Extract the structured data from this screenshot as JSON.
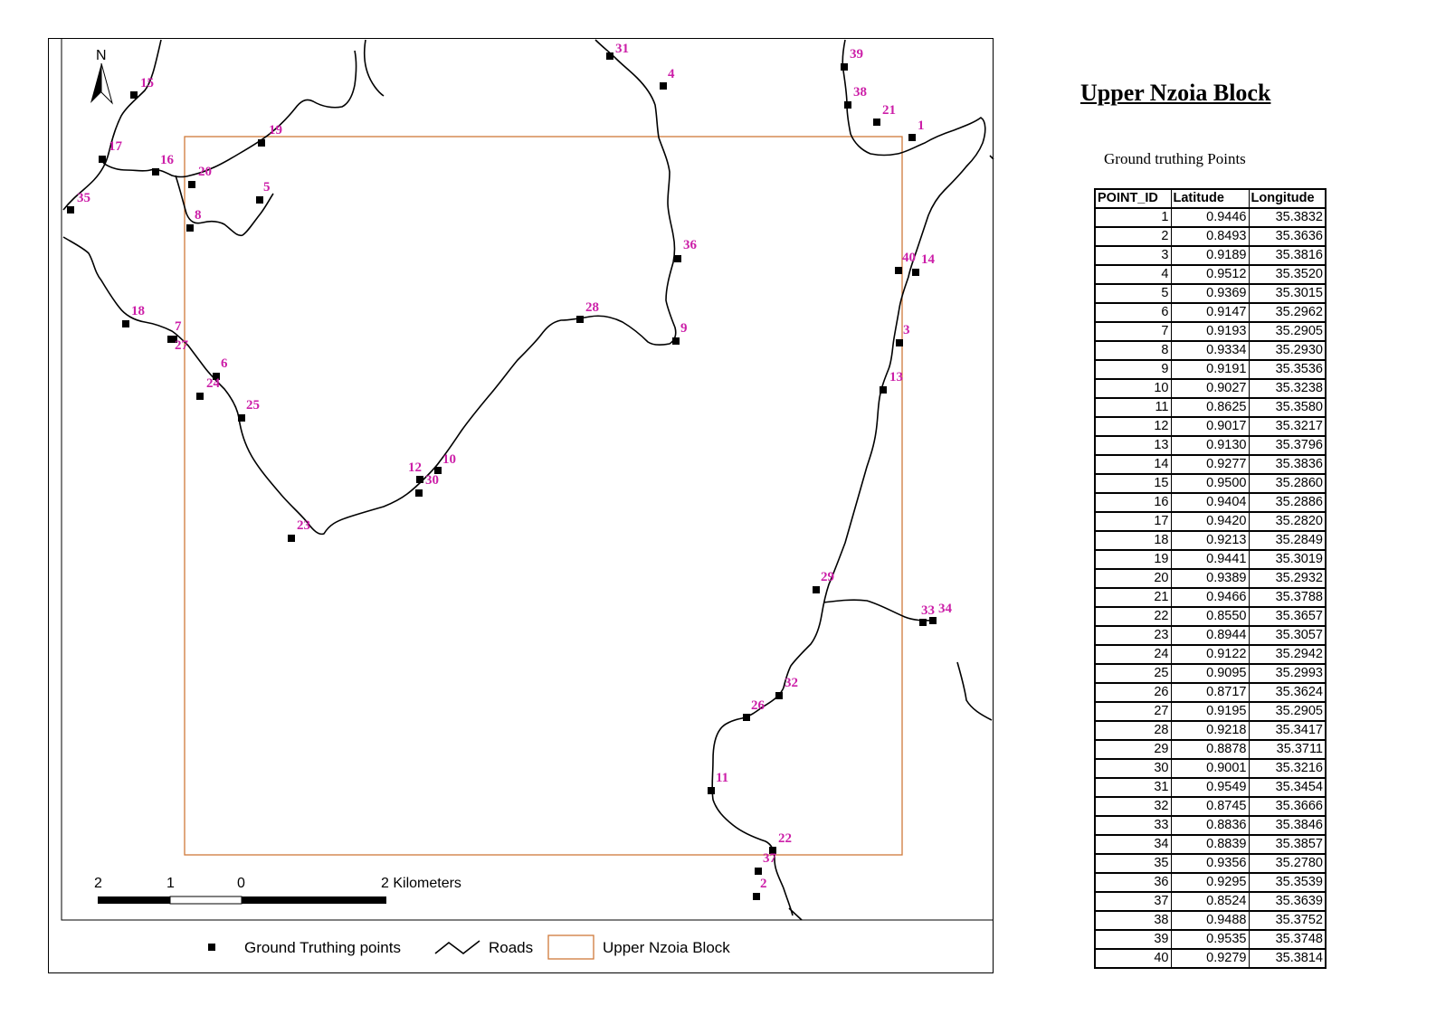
{
  "map": {
    "north_label": "N",
    "scale_labels": [
      "2",
      "1",
      "0",
      "2 Kilometers"
    ],
    "legend": {
      "points_label": "Ground Truthing points",
      "roads_label": "Roads",
      "block_label": "Upper Nzoia Block"
    },
    "colors": {
      "point_label": "#cc1fa8",
      "block_outline": "#d07a3a",
      "roads": "#000000",
      "points": "#000000"
    },
    "point_labels": [
      "1",
      "2",
      "3",
      "4",
      "5",
      "6",
      "7",
      "8",
      "9",
      "10",
      "11",
      "12",
      "13",
      "14",
      "15",
      "16",
      "17",
      "18",
      "19",
      "20",
      "21",
      "22",
      "23",
      "24",
      "25",
      "26",
      "27",
      "28",
      "29",
      "30",
      "31",
      "32",
      "33",
      "34",
      "35",
      "36",
      "37",
      "38",
      "39",
      "40"
    ]
  },
  "panel": {
    "title": "Upper Nzoia Block",
    "subtitle": "Ground truthing Points"
  },
  "table": {
    "headers": [
      "POINT_ID",
      "Latitude",
      "Longitude"
    ],
    "rows": [
      [
        "1",
        "0.9446",
        "35.3832"
      ],
      [
        "2",
        "0.8493",
        "35.3636"
      ],
      [
        "3",
        "0.9189",
        "35.3816"
      ],
      [
        "4",
        "0.9512",
        "35.3520"
      ],
      [
        "5",
        "0.9369",
        "35.3015"
      ],
      [
        "6",
        "0.9147",
        "35.2962"
      ],
      [
        "7",
        "0.9193",
        "35.2905"
      ],
      [
        "8",
        "0.9334",
        "35.2930"
      ],
      [
        "9",
        "0.9191",
        "35.3536"
      ],
      [
        "10",
        "0.9027",
        "35.3238"
      ],
      [
        "11",
        "0.8625",
        "35.3580"
      ],
      [
        "12",
        "0.9017",
        "35.3217"
      ],
      [
        "13",
        "0.9130",
        "35.3796"
      ],
      [
        "14",
        "0.9277",
        "35.3836"
      ],
      [
        "15",
        "0.9500",
        "35.2860"
      ],
      [
        "16",
        "0.9404",
        "35.2886"
      ],
      [
        "17",
        "0.9420",
        "35.2820"
      ],
      [
        "18",
        "0.9213",
        "35.2849"
      ],
      [
        "19",
        "0.9441",
        "35.3019"
      ],
      [
        "20",
        "0.9389",
        "35.2932"
      ],
      [
        "21",
        "0.9466",
        "35.3788"
      ],
      [
        "22",
        "0.8550",
        "35.3657"
      ],
      [
        "23",
        "0.8944",
        "35.3057"
      ],
      [
        "24",
        "0.9122",
        "35.2942"
      ],
      [
        "25",
        "0.9095",
        "35.2993"
      ],
      [
        "26",
        "0.8717",
        "35.3624"
      ],
      [
        "27",
        "0.9195",
        "35.2905"
      ],
      [
        "28",
        "0.9218",
        "35.3417"
      ],
      [
        "29",
        "0.8878",
        "35.3711"
      ],
      [
        "30",
        "0.9001",
        "35.3216"
      ],
      [
        "31",
        "0.9549",
        "35.3454"
      ],
      [
        "32",
        "0.8745",
        "35.3666"
      ],
      [
        "33",
        "0.8836",
        "35.3846"
      ],
      [
        "34",
        "0.8839",
        "35.3857"
      ],
      [
        "35",
        "0.9356",
        "35.2780"
      ],
      [
        "36",
        "0.9295",
        "35.3539"
      ],
      [
        "37",
        "0.8524",
        "35.3639"
      ],
      [
        "38",
        "0.9488",
        "35.3752"
      ],
      [
        "39",
        "0.9535",
        "35.3748"
      ],
      [
        "40",
        "0.9279",
        "35.3814"
      ]
    ]
  }
}
